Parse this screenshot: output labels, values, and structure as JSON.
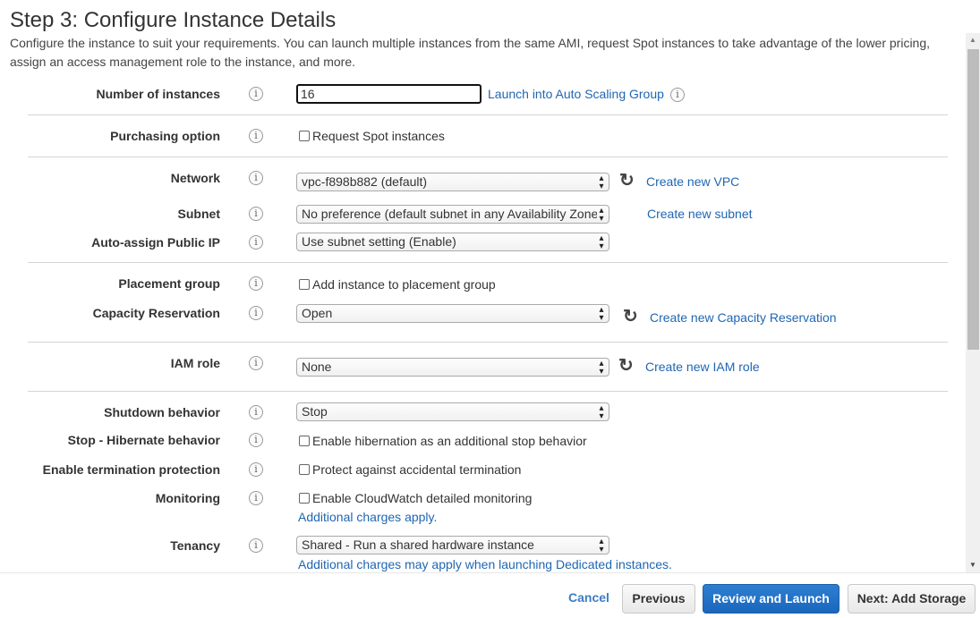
{
  "page": {
    "title": "Step 3: Configure Instance Details",
    "description": "Configure the instance to suit your requirements. You can launch multiple instances from the same AMI, request Spot instances to take advantage of the lower pricing, assign an access management role to the instance, and more."
  },
  "form": {
    "number_of_instances": {
      "label": "Number of instances",
      "value": "16",
      "link": "Launch into Auto Scaling Group"
    },
    "purchasing_option": {
      "label": "Purchasing option",
      "checkbox": "Request Spot instances",
      "checked": false
    },
    "network": {
      "label": "Network",
      "value": "vpc-f898b882 (default)",
      "link": "Create new VPC"
    },
    "subnet": {
      "label": "Subnet",
      "value": "No preference (default subnet in any Availability Zone)",
      "link": "Create new subnet"
    },
    "auto_assign_ip": {
      "label": "Auto-assign Public IP",
      "value": "Use subnet setting (Enable)"
    },
    "placement_group": {
      "label": "Placement group",
      "checkbox": "Add instance to placement group",
      "checked": false
    },
    "capacity_reservation": {
      "label": "Capacity Reservation",
      "value": "Open",
      "link": "Create new Capacity Reservation"
    },
    "iam_role": {
      "label": "IAM role",
      "value": "None",
      "link": "Create new IAM role"
    },
    "shutdown_behavior": {
      "label": "Shutdown behavior",
      "value": "Stop"
    },
    "hibernate": {
      "label": "Stop - Hibernate behavior",
      "checkbox": "Enable hibernation as an additional stop behavior",
      "checked": false
    },
    "termination_protection": {
      "label": "Enable termination protection",
      "checkbox": "Protect against accidental termination",
      "checked": false
    },
    "monitoring": {
      "label": "Monitoring",
      "checkbox": "Enable CloudWatch detailed monitoring",
      "checked": false,
      "note": "Additional charges apply."
    },
    "tenancy": {
      "label": "Tenancy",
      "value": "Shared - Run a shared hardware instance",
      "note": "Additional charges may apply when launching Dedicated instances."
    }
  },
  "icons": {
    "info": "i",
    "refresh": "↻",
    "select_arrows": "▴▾",
    "scroll_up": "▲",
    "scroll_down": "▼"
  },
  "footer": {
    "cancel": "Cancel",
    "previous": "Previous",
    "review": "Review and Launch",
    "next": "Next: Add Storage"
  },
  "colors": {
    "link": "#1f66b3",
    "primary_button": "#1a66bd"
  }
}
